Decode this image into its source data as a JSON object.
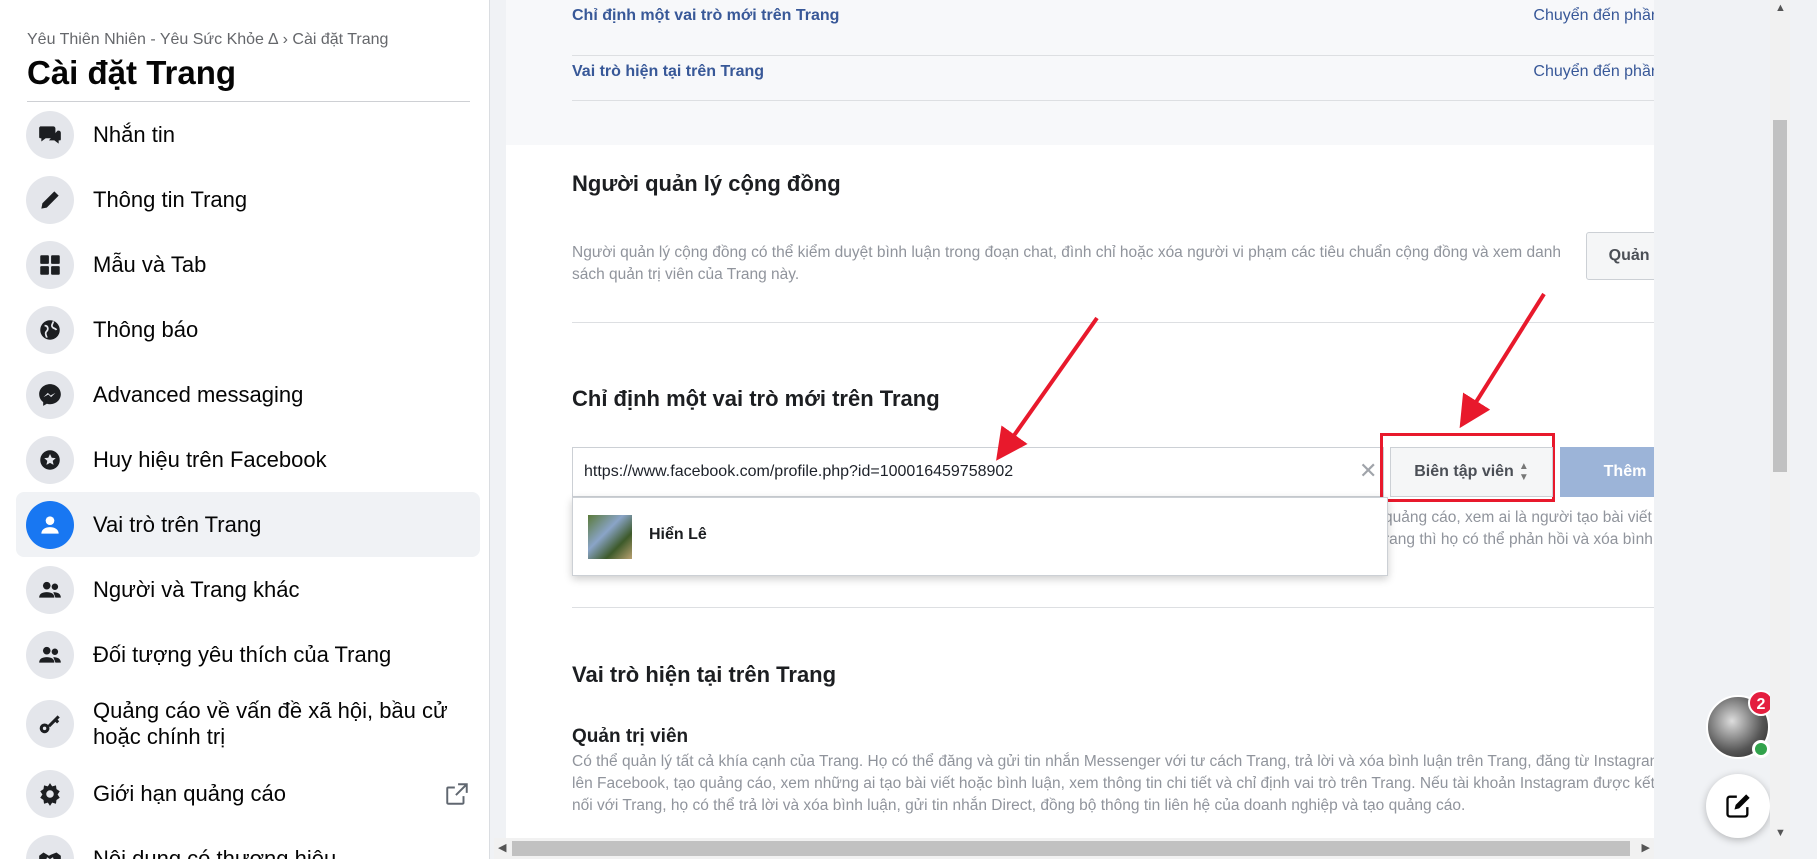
{
  "sidebar": {
    "breadcrumb": "Yêu Thiên Nhiên - Yêu Sức Khỏe ∆ › Cài đặt Trang",
    "title": "Cài đặt Trang",
    "items": [
      {
        "label": "Nhắn tin",
        "icon": "messenger-chat-icon"
      },
      {
        "label": "Thông tin Trang",
        "icon": "pencil-icon"
      },
      {
        "label": "Mẫu và Tab",
        "icon": "grid-icon"
      },
      {
        "label": "Thông báo",
        "icon": "globe-icon"
      },
      {
        "label": "Advanced messaging",
        "icon": "messenger-icon"
      },
      {
        "label": "Huy hiệu trên Facebook",
        "icon": "star-badge-icon"
      },
      {
        "label": "Vai trò trên Trang",
        "icon": "person-icon",
        "active": true
      },
      {
        "label": "Người và Trang khác",
        "icon": "people-icon"
      },
      {
        "label": "Đối tượng yêu thích của Trang",
        "icon": "people-icon"
      },
      {
        "label": "Quảng cáo về vấn đề xã hội, bầu cử hoặc chính trị",
        "icon": "key-icon"
      },
      {
        "label": "Giới hạn quảng cáo",
        "icon": "gear-icon",
        "external": true
      },
      {
        "label": "Nội dung có thương hiệu",
        "icon": "handshake-icon"
      }
    ]
  },
  "main": {
    "links": [
      {
        "label": "Chỉ định một vai trò mới trên Trang",
        "action": "Chuyển đến phần này"
      },
      {
        "label": "Vai trò hiện tại trên Trang",
        "action": "Chuyển đến phần này"
      }
    ],
    "community": {
      "title": "Người quản lý cộng đồng",
      "desc": "Người quản lý cộng đồng có thể kiểm duyệt bình luận trong đoạn chat, đình chỉ hoặc xóa người vi phạm các tiêu chuẩn cộng đồng và xem danh sách quản trị viên của Trang này.",
      "button": "Quản lý"
    },
    "assign": {
      "title": "Chỉ định một vai trò mới trên Trang",
      "input_value": "https://www.facebook.com/profile.php?id=100016459758902",
      "clear": "✕",
      "role": "Biên tập viên",
      "add_button": "Thêm",
      "suggestion_name": "Hiển Lê",
      "partial_desc_1": "quảng cáo, xem ai là người tạo bài viết",
      "partial_desc_2": "rang thì họ có thể phản hồi và xóa bình"
    },
    "current": {
      "title": "Vai trò hiện tại trên Trang",
      "subtitle": "Quản trị viên",
      "desc": "Có thể quản lý tất cả khía cạnh của Trang. Họ có thể đăng và gửi tin nhắn Messenger với tư cách Trang, trả lời và xóa bình luận trên Trang, đăng từ Instagram lên Facebook, tạo quảng cáo, xem những ai tạo bài viết hoặc bình luận, xem thông tin chi tiết và chỉ định vai trò trên Trang. Nếu tài khoản Instagram được kết nối với Trang, họ có thể trả lời và xóa bình luận, gửi tin nhắn Direct, đồng bộ thông tin liên hệ của doanh nghiệp và tạo quảng cáo."
    }
  },
  "chat": {
    "badge_count": "2"
  },
  "colors": {
    "accent": "#1877f2",
    "link": "#385898",
    "highlight": "#e8192c"
  }
}
